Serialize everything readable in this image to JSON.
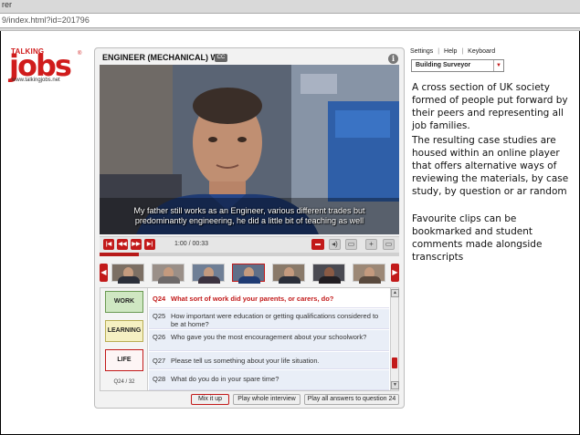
{
  "browser": {
    "title": "rer",
    "url": "9/index.html?id=201796"
  },
  "logo": {
    "top_text": "TALKING",
    "main_text": "jobs",
    "url_text": "www.talkingjobs.net",
    "reg": "®",
    "brand_color": "#d01c1c"
  },
  "player": {
    "title": "ENGINEER (MECHANICAL) Wil",
    "cc_badge": "CC",
    "info_icon": "i",
    "subtitle_line1": "My father still works as an Engineer, various different trades but",
    "subtitle_line2": "predominantly engineering, he did a little bit of teaching as well",
    "time": "1:00 / 00:33",
    "progress": 0.13,
    "controls": {
      "buttons": [
        "|◀",
        "◀◀",
        "▶▶",
        "▶|"
      ],
      "icons": [
        "comment-icon",
        "volume-icon",
        "caption-icon",
        "add-icon",
        "fullscreen-icon"
      ]
    }
  },
  "categories": {
    "work": "WORK",
    "learning": "LEARNING",
    "life": "LIFE",
    "count": "Q24 / 32"
  },
  "questions": [
    {
      "num": "Q24",
      "text": "What sort of work did your parents, or carers, do?",
      "active": true
    },
    {
      "num": "Q25",
      "text": "How important were education or getting qualifications considered to be at home?",
      "active": false
    },
    {
      "num": "Q26",
      "text": "Who gave you the most encouragement about your schoolwork?",
      "active": false
    },
    {
      "num": "Q27",
      "text": "Please tell us something about your life situation.",
      "active": false
    },
    {
      "num": "Q28",
      "text": "What do you do in your spare time?",
      "active": false
    }
  ],
  "actions": {
    "mix": "Mix it up",
    "play_whole": "Play whole interview",
    "play_all": "Play all answers to question 24"
  },
  "top_links": {
    "settings": "Settings",
    "help": "Help",
    "keyboard": "Keyboard",
    "sep": "|"
  },
  "select": {
    "value": "Building Surveyor"
  },
  "description": {
    "para1": "A cross section of UK society formed of people put forward by their peers and representing all job families.",
    "para2": "The resulting case studies are housed within an online player that offers alternative ways of reviewing the materials, by case study, by question  or ar random",
    "para3": "Favourite clips can be bookmarked and student comments made alongside transcripts"
  }
}
